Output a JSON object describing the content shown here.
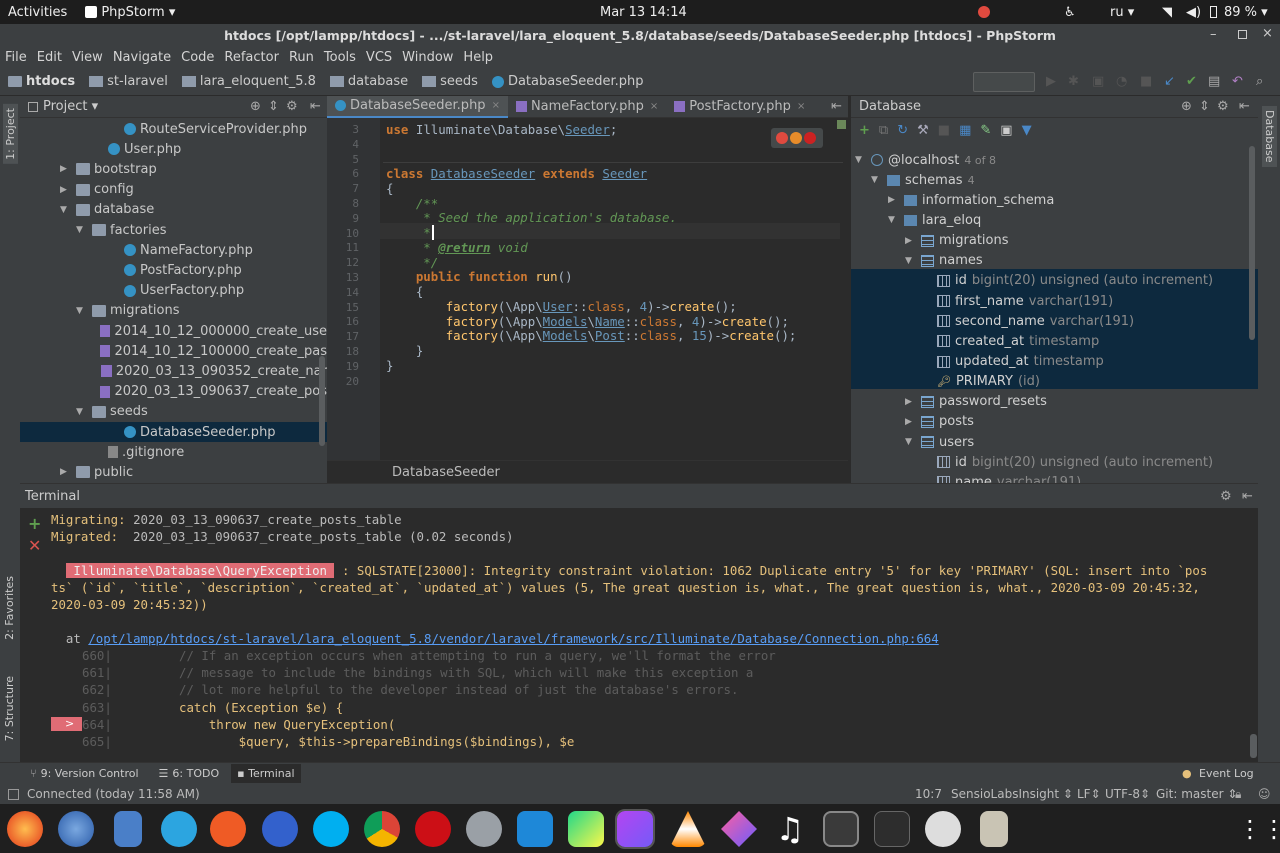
{
  "topbar": {
    "activities": "Activities",
    "app": "PhpStorm",
    "app_arrow": "▾",
    "clock": "Mar 13  14:14",
    "lang": "ru",
    "lang_arrow": "▾",
    "battery": "89 %",
    "battery_arrow": "▾"
  },
  "window": {
    "title": "htdocs [/opt/lampp/htdocs] - .../st-laravel/lara_eloquent_5.8/database/seeds/DatabaseSeeder.php [htdocs] - PhpStorm"
  },
  "menu": [
    "File",
    "Edit",
    "View",
    "Navigate",
    "Code",
    "Refactor",
    "Run",
    "Tools",
    "VCS",
    "Window",
    "Help"
  ],
  "breadcrumb": [
    "htdocs",
    "st-laravel",
    "lara_eloquent_5.8",
    "database",
    "seeds",
    "DatabaseSeeder.php"
  ],
  "sidestrip": {
    "project": "1: Project",
    "favorites": "2: Favorites",
    "structure": "7: Structure",
    "database": "Database"
  },
  "project": {
    "header": "Project",
    "header_arrow": "▾",
    "items": [
      {
        "label": "RouteServiceProvider.php",
        "kind": "php",
        "depth": 6
      },
      {
        "label": "User.php",
        "kind": "php",
        "depth": 5
      },
      {
        "label": "bootstrap",
        "kind": "folder",
        "depth": 3,
        "arrow": "▶"
      },
      {
        "label": "config",
        "kind": "folder",
        "depth": 3,
        "arrow": "▶"
      },
      {
        "label": "database",
        "kind": "folder",
        "depth": 3,
        "arrow": "▼"
      },
      {
        "label": "factories",
        "kind": "folder",
        "depth": 4,
        "arrow": "▼"
      },
      {
        "label": "NameFactory.php",
        "kind": "php",
        "depth": 6
      },
      {
        "label": "PostFactory.php",
        "kind": "php",
        "depth": 6
      },
      {
        "label": "UserFactory.php",
        "kind": "php",
        "depth": 6
      },
      {
        "label": "migrations",
        "kind": "folder",
        "depth": 4,
        "arrow": "▼"
      },
      {
        "label": "2014_10_12_000000_create_use",
        "kind": "mig",
        "depth": 6
      },
      {
        "label": "2014_10_12_100000_create_pas",
        "kind": "mig",
        "depth": 6
      },
      {
        "label": "2020_03_13_090352_create_nar",
        "kind": "mig",
        "depth": 6
      },
      {
        "label": "2020_03_13_090637_create_pos",
        "kind": "mig",
        "depth": 6
      },
      {
        "label": "seeds",
        "kind": "folder",
        "depth": 4,
        "arrow": "▼"
      },
      {
        "label": "DatabaseSeeder.php",
        "kind": "php",
        "depth": 6,
        "selected": true
      },
      {
        "label": ".gitignore",
        "kind": "file",
        "depth": 5
      },
      {
        "label": "public",
        "kind": "folder",
        "depth": 3,
        "arrow": "▶"
      }
    ]
  },
  "editor": {
    "tabs": [
      {
        "label": "DatabaseSeeder.php",
        "active": true
      },
      {
        "label": "NameFactory.php"
      },
      {
        "label": "PostFactory.php"
      }
    ],
    "tab_close": "×",
    "line_numbers": [
      "3",
      "4",
      "5",
      "6",
      "7",
      "8",
      "9",
      "10",
      "11",
      "12",
      "13",
      "14",
      "15",
      "16",
      "17",
      "18",
      "19",
      "20"
    ],
    "code_crumb": "DatabaseSeeder"
  },
  "database": {
    "header": "Database",
    "items": [
      {
        "label": "@localhost",
        "meta": "4 of 8",
        "depth": 0,
        "arrow": "▼"
      },
      {
        "label": "schemas",
        "meta": "4",
        "depth": 1,
        "arrow": "▼"
      },
      {
        "label": "information_schema",
        "meta": "",
        "depth": 2,
        "arrow": "▶"
      },
      {
        "label": "lara_eloq",
        "meta": "",
        "depth": 2,
        "arrow": "▼"
      },
      {
        "label": "migrations",
        "meta": "",
        "depth": 3,
        "arrow": "▶"
      },
      {
        "label": "names",
        "meta": "",
        "depth": 3,
        "arrow": "▼",
        "sel": true
      },
      {
        "label": "id",
        "meta": "bigint(20) unsigned (auto increment)",
        "depth": 4,
        "sel": true
      },
      {
        "label": "first_name",
        "meta": "varchar(191)",
        "depth": 4,
        "sel": true
      },
      {
        "label": "second_name",
        "meta": "varchar(191)",
        "depth": 4,
        "sel": true
      },
      {
        "label": "created_at",
        "meta": "timestamp",
        "depth": 4,
        "sel": true
      },
      {
        "label": "updated_at",
        "meta": "timestamp",
        "depth": 4,
        "sel": true
      },
      {
        "label": "PRIMARY",
        "meta": "(id)",
        "depth": 4,
        "sel": true,
        "key": true
      },
      {
        "label": "password_resets",
        "meta": "",
        "depth": 3,
        "arrow": "▶"
      },
      {
        "label": "posts",
        "meta": "",
        "depth": 3,
        "arrow": "▶"
      },
      {
        "label": "users",
        "meta": "",
        "depth": 3,
        "arrow": "▼"
      },
      {
        "label": "id",
        "meta": "bigint(20) unsigned (auto increment)",
        "depth": 4
      },
      {
        "label": "name",
        "meta": "varchar(191)",
        "depth": 4
      }
    ]
  },
  "terminal": {
    "header": "Terminal",
    "line1_label": "Migrating:",
    "line1_val": " 2020_03_13_090637_create_posts_table",
    "line2_label": "Migrated:",
    "line2_val": "  2020_03_13_090637_create_posts_table (0.02 seconds)",
    "exception": " Illuminate\\Database\\QueryException ",
    "err1": " : SQLSTATE[23000]: Integrity constraint violation: 1062 Duplicate entry '5' for key 'PRIMARY' (SQL: insert into `pos",
    "err2": "ts` (`id`, `title`, `description`, `created_at`, `updated_at`) values (5, The great question is, what., The great question is, what., 2020-03-09 20:45:32,",
    "err3": "2020-03-09 20:45:32))",
    "at": "  at ",
    "path": "/opt/lampp/htdocs/st-laravel/lara_eloquent_5.8/vendor/laravel/framework/src/Illuminate/Database/Connection.php:664",
    "arrow": ">",
    "src": [
      {
        "n": "660|",
        "t": "         // If an exception occurs when attempting to run a query, we'll format the error"
      },
      {
        "n": "661|",
        "t": "         // message to include the bindings with SQL, which will make this exception a"
      },
      {
        "n": "662|",
        "t": "         // lot more helpful to the developer instead of just the database's errors."
      },
      {
        "n": "663|",
        "t": "         catch (Exception $e) {"
      },
      {
        "n": "664|",
        "t": "             throw new QueryException("
      },
      {
        "n": "665|",
        "t": "                 $query, $this->prepareBindings($bindings), $e"
      }
    ]
  },
  "bottomtabs": {
    "version": "9: Version Control",
    "todo": "6: TODO",
    "terminal": "Terminal",
    "eventlog": "Event Log"
  },
  "status": {
    "connected": "Connected (today 11:58 AM)",
    "pos": "10:7",
    "insight": "SensioLabsInsight ⇕",
    "lf": "LF⇕",
    "enc": "UTF-8⇕",
    "git": "Git: master ⇕"
  },
  "colors": {
    "accent": "#4a88c7",
    "selection": "#0d293e",
    "error": "#e06c75"
  }
}
